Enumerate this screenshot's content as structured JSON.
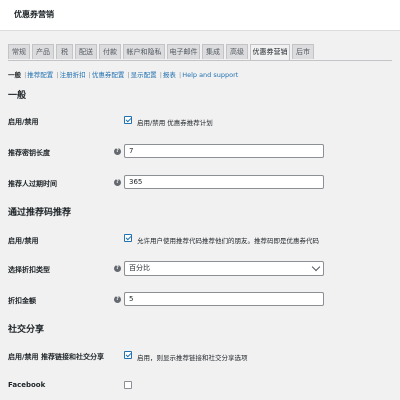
{
  "app": {
    "title": "优惠券营销"
  },
  "tabs": [
    {
      "label": "常规"
    },
    {
      "label": "产品"
    },
    {
      "label": "税"
    },
    {
      "label": "配送"
    },
    {
      "label": "付款"
    },
    {
      "label": "帐户和隐私"
    },
    {
      "label": "电子邮件"
    },
    {
      "label": "集成"
    },
    {
      "label": "高级"
    },
    {
      "label": "优惠券营销"
    },
    {
      "label": "后市"
    }
  ],
  "active_tab": "优惠券营销",
  "subnav": {
    "current": "一般",
    "links": [
      "推荐配置",
      "注册折扣",
      "优惠券配置",
      "显示配置",
      "报表",
      "Help and support"
    ]
  },
  "general": {
    "title": "一般",
    "enable_label": "启用/禁用",
    "enable_text": "启用/禁用 优惠券推荐计划",
    "enable_checked": true,
    "code_length_label": "推荐密钥长度",
    "code_length_value": "7",
    "expiry_label": "推荐人过期时间",
    "expiry_value": "365"
  },
  "referral": {
    "title": "通过推荐码推荐",
    "enable_label": "启用/禁用",
    "enable_text": "允许用户使用推荐代码推荐他们的朋友。推荐码即是优惠券代码",
    "enable_checked": true,
    "discount_type_label": "选择折扣类型",
    "discount_type_value": "百分比",
    "discount_amount_label": "折扣金额",
    "discount_amount_value": "5"
  },
  "social": {
    "title": "社交分享",
    "enable_label": "启用/禁用 推荐链接和社交分享",
    "enable_text": "启用，则显示推荐链接和社交分享选项",
    "enable_checked": true,
    "facebook_label": "Facebook",
    "facebook_checked": false
  }
}
